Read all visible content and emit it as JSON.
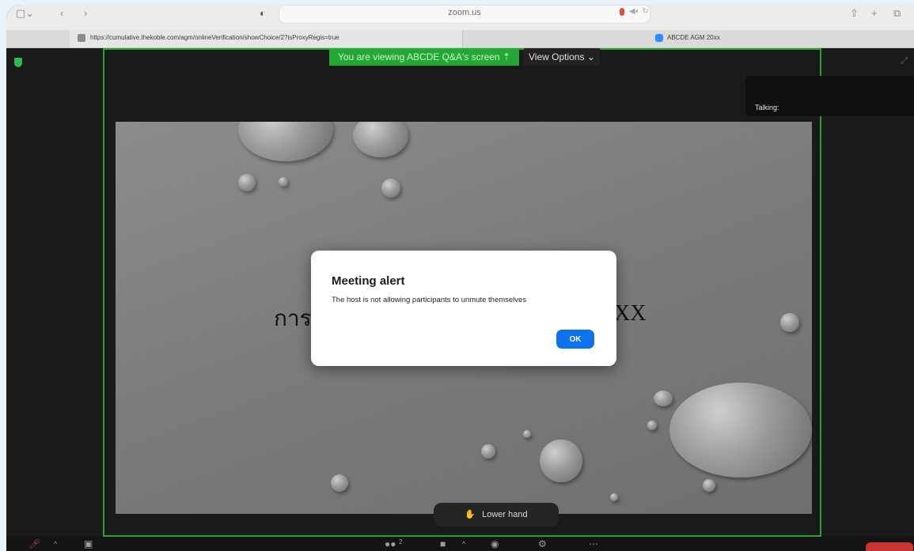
{
  "browser": {
    "address": "zoom.us",
    "tabs": [
      {
        "title": "https://cumulative.thekoble.com/agm/onlineVerification/showChoice/2?isProxyRegis=true"
      },
      {
        "title": "ABCDE AGM 20xx"
      }
    ]
  },
  "meeting": {
    "banner": "You are viewing ABCDE Q&A's screen",
    "view_options": "View Options",
    "talking_label": "Talking:",
    "slide_text_left": "การ",
    "slide_text_right": "XX",
    "lower_hand_label": "Lower hand",
    "participants_count": "2"
  },
  "dialog": {
    "title": "Meeting alert",
    "message": "The host is not allowing participants to unmute themselves",
    "ok_label": "OK"
  },
  "colors": {
    "share_border": "#22a62a",
    "ok_button": "#0e72ed",
    "end_button": "#c6352f"
  }
}
